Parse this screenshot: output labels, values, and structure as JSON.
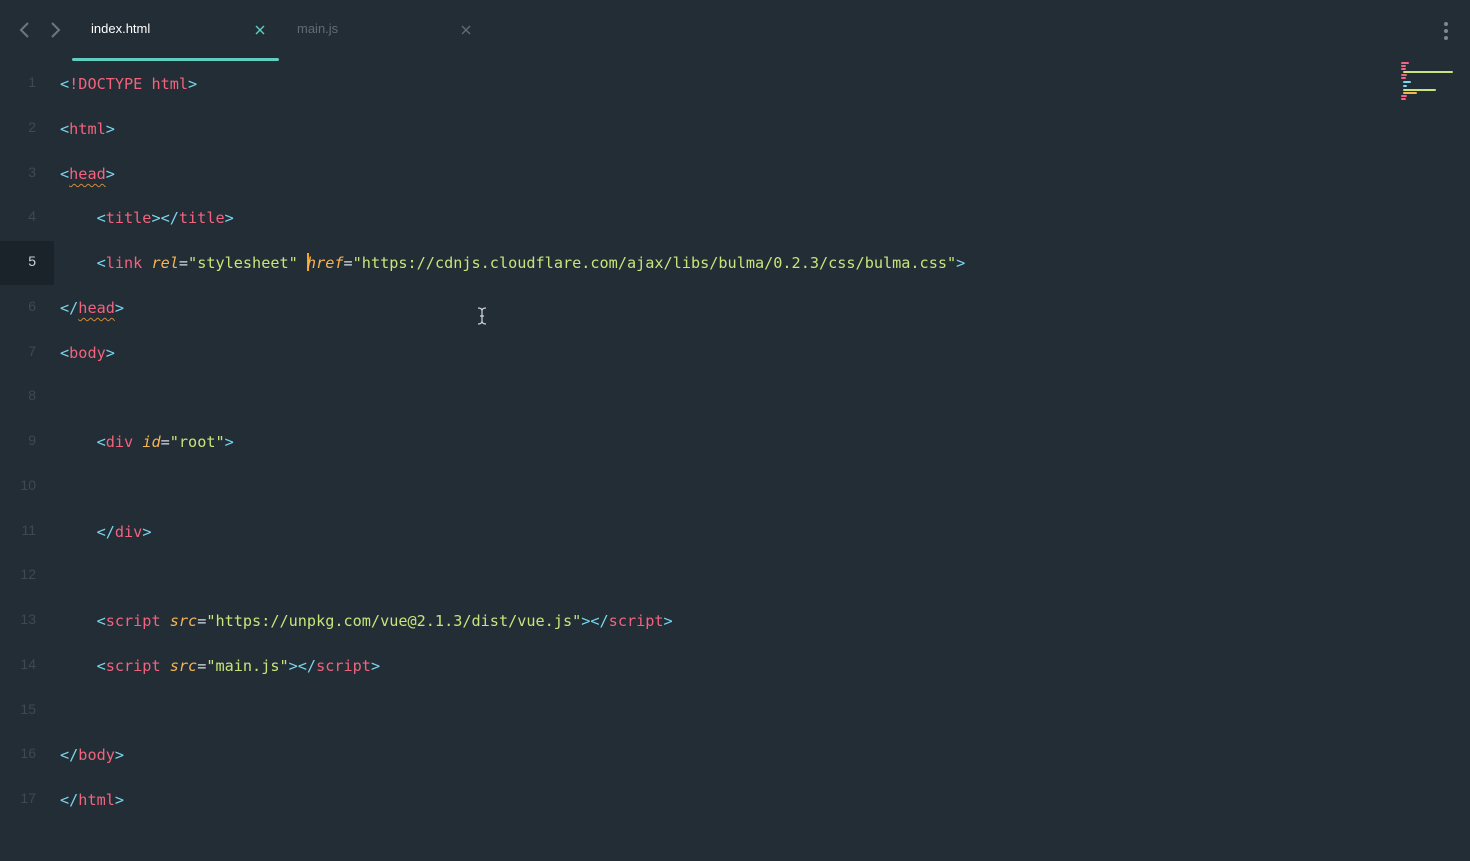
{
  "tabs": [
    {
      "label": "index.html",
      "active": true
    },
    {
      "label": "main.js",
      "active": false
    }
  ],
  "icons": {
    "back": "chevron-left-icon",
    "forward": "chevron-right-icon",
    "close": "close-icon",
    "menu": "more-vertical-icon"
  },
  "colors": {
    "background": "#232d35",
    "tag": "#f2637e",
    "punctuation": "#7ad7ee",
    "attribute": "#f7b455",
    "string": "#c4e67b",
    "active_tab_underline": "#5fcfc2",
    "caret": "#f5a623"
  },
  "current_line": 5,
  "lines": [
    {
      "n": "1",
      "tokens": [
        [
          "p",
          "<"
        ],
        [
          "tag",
          "!DOCTYPE html"
        ],
        [
          "p",
          ">"
        ]
      ]
    },
    {
      "n": "2",
      "tokens": [
        [
          "p",
          "<"
        ],
        [
          "tag",
          "html"
        ],
        [
          "p",
          ">"
        ]
      ]
    },
    {
      "n": "3",
      "tokens": [
        [
          "p",
          "<"
        ],
        [
          "tag squig",
          "head"
        ],
        [
          "p",
          ">"
        ]
      ]
    },
    {
      "n": "4",
      "tokens": [
        [
          "",
          "    "
        ],
        [
          "p",
          "<"
        ],
        [
          "tag",
          "title"
        ],
        [
          "p",
          "></"
        ],
        [
          "tag",
          "title"
        ],
        [
          "p",
          ">"
        ]
      ]
    },
    {
      "n": "5",
      "tokens": [
        [
          "",
          "    "
        ],
        [
          "p",
          "<"
        ],
        [
          "tag",
          "link "
        ],
        [
          "attr",
          "rel"
        ],
        [
          "eq",
          "="
        ],
        [
          "str",
          "\"stylesheet\" "
        ],
        [
          "caret",
          ""
        ],
        [
          "attr",
          "href"
        ],
        [
          "eq",
          "="
        ],
        [
          "str",
          "\"https://cdnjs.cloudflare.com/ajax/libs/bulma/0.2.3/css/bulma.css\""
        ],
        [
          "p",
          ">"
        ]
      ]
    },
    {
      "n": "6",
      "tokens": [
        [
          "p",
          "</"
        ],
        [
          "tag squig",
          "head"
        ],
        [
          "p",
          ">"
        ]
      ]
    },
    {
      "n": "7",
      "tokens": [
        [
          "p",
          "<"
        ],
        [
          "tag",
          "body"
        ],
        [
          "p",
          ">"
        ]
      ]
    },
    {
      "n": "8",
      "tokens": []
    },
    {
      "n": "9",
      "tokens": [
        [
          "",
          "    "
        ],
        [
          "p",
          "<"
        ],
        [
          "tag",
          "div "
        ],
        [
          "attr",
          "id"
        ],
        [
          "eq",
          "="
        ],
        [
          "str",
          "\"root\""
        ],
        [
          "p",
          ">"
        ]
      ]
    },
    {
      "n": "10",
      "tokens": []
    },
    {
      "n": "11",
      "tokens": [
        [
          "",
          "    "
        ],
        [
          "p",
          "</"
        ],
        [
          "tag",
          "div"
        ],
        [
          "p",
          ">"
        ]
      ]
    },
    {
      "n": "12",
      "tokens": []
    },
    {
      "n": "13",
      "tokens": [
        [
          "",
          "    "
        ],
        [
          "p",
          "<"
        ],
        [
          "tag",
          "script "
        ],
        [
          "attr",
          "src"
        ],
        [
          "eq",
          "="
        ],
        [
          "str",
          "\"https://unpkg.com/vue@2.1.3/dist/vue.js\""
        ],
        [
          "p",
          "></"
        ],
        [
          "tag",
          "script"
        ],
        [
          "p",
          ">"
        ]
      ]
    },
    {
      "n": "14",
      "tokens": [
        [
          "",
          "    "
        ],
        [
          "p",
          "<"
        ],
        [
          "tag",
          "script "
        ],
        [
          "attr",
          "src"
        ],
        [
          "eq",
          "="
        ],
        [
          "str",
          "\"main.js\""
        ],
        [
          "p",
          "></"
        ],
        [
          "tag",
          "script"
        ],
        [
          "p",
          ">"
        ]
      ]
    },
    {
      "n": "15",
      "tokens": []
    },
    {
      "n": "16",
      "tokens": [
        [
          "p",
          "</"
        ],
        [
          "tag",
          "body"
        ],
        [
          "p",
          ">"
        ]
      ]
    },
    {
      "n": "17",
      "tokens": [
        [
          "p",
          "</"
        ],
        [
          "tag",
          "html"
        ],
        [
          "p",
          ">"
        ]
      ]
    }
  ]
}
